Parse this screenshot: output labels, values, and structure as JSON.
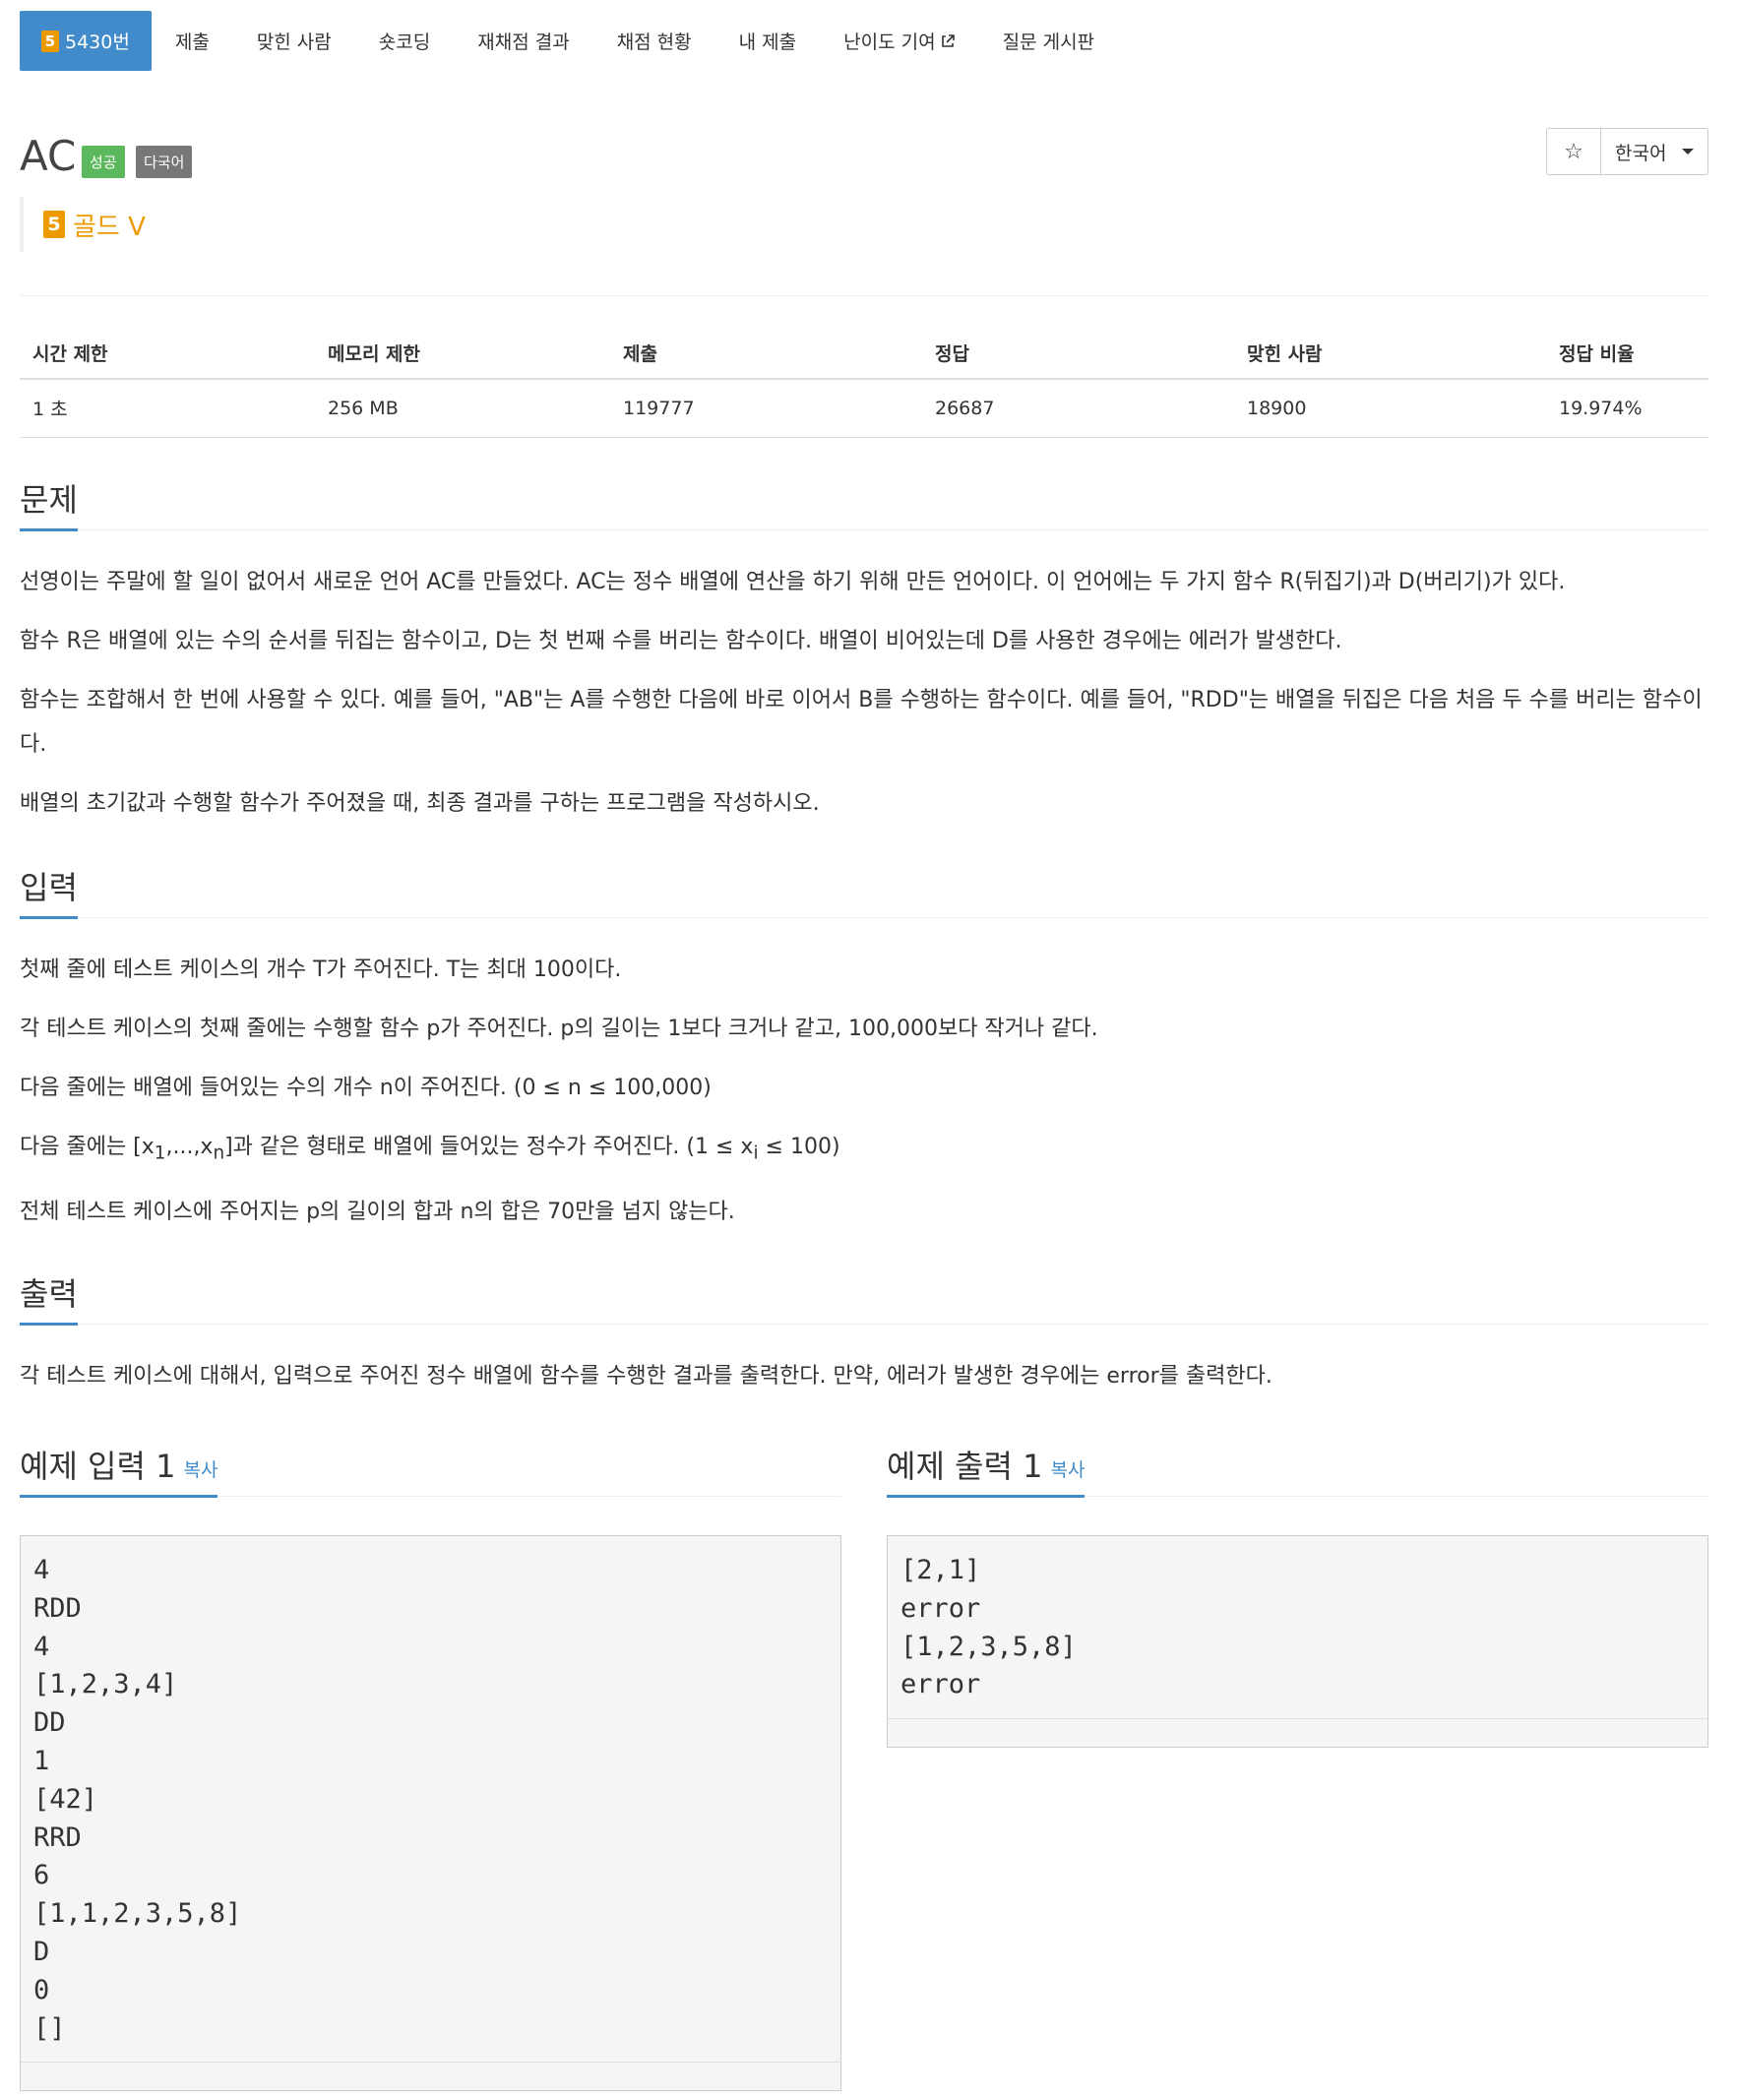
{
  "nav": {
    "problem_tier": "5",
    "problem_id": "5430번",
    "items": [
      "제출",
      "맞힌 사람",
      "숏코딩",
      "재채점 결과",
      "채점 현황",
      "내 제출",
      "난이도 기여",
      "질문 게시판"
    ]
  },
  "title": {
    "text": "AC",
    "label_success": "성공",
    "label_multilang": "다국어",
    "star": "☆",
    "language": "한국어",
    "tier_number": "5",
    "tier_text": "골드 V"
  },
  "stats": {
    "headers": [
      "시간 제한",
      "메모리 제한",
      "제출",
      "정답",
      "맞힌 사람",
      "정답 비율"
    ],
    "values": [
      "1 초",
      "256 MB",
      "119777",
      "26687",
      "18900",
      "19.974%"
    ]
  },
  "problem": {
    "title": "문제",
    "paragraphs": [
      "선영이는 주말에 할 일이 없어서 새로운 언어 AC를 만들었다. AC는 정수 배열에 연산을 하기 위해 만든 언어이다. 이 언어에는 두 가지 함수 R(뒤집기)과 D(버리기)가 있다.",
      "함수 R은 배열에 있는 수의 순서를 뒤집는 함수이고, D는 첫 번째 수를 버리는 함수이다. 배열이 비어있는데 D를 사용한 경우에는 에러가 발생한다.",
      "함수는 조합해서 한 번에 사용할 수 있다. 예를 들어, \"AB\"는 A를 수행한 다음에 바로 이어서 B를 수행하는 함수이다. 예를 들어, \"RDD\"는 배열을 뒤집은 다음 처음 두 수를 버리는 함수이다.",
      "배열의 초기값과 수행할 함수가 주어졌을 때, 최종 결과를 구하는 프로그램을 작성하시오."
    ]
  },
  "input": {
    "title": "입력",
    "p1": "첫째 줄에 테스트 케이스의 개수 T가 주어진다. T는 최대 100이다.",
    "p2": "각 테스트 케이스의 첫째 줄에는 수행할 함수 p가 주어진다. p의 길이는 1보다 크거나 같고, 100,000보다 작거나 같다.",
    "p3": "다음 줄에는 배열에 들어있는 수의 개수 n이 주어진다. (0 ≤ n ≤ 100,000)",
    "p4_prefix": "다음 줄에는 [x",
    "p4_sub1": "1",
    "p4_mid": ",...,x",
    "p4_subn": "n",
    "p4_suffix": "]과 같은 형태로 배열에 들어있는 정수가 주어진다. (1 ≤ x",
    "p4_subi": "i",
    "p4_end": " ≤ 100)",
    "p5": "전체 테스트 케이스에 주어지는 p의 길이의 합과 n의 합은 70만을 넘지 않는다."
  },
  "output": {
    "title": "출력",
    "p1": "각 테스트 케이스에 대해서, 입력으로 주어진 정수 배열에 함수를 수행한 결과를 출력한다. 만약, 에러가 발생한 경우에는 error를 출력한다."
  },
  "sample_input": {
    "title": "예제 입력 1",
    "copy": "복사",
    "lines": [
      "4",
      "RDD",
      "4",
      "[1,2,3,4]",
      "DD",
      "1",
      "[42]",
      "RRD",
      "6",
      "[1,1,2,3,5,8]",
      "D",
      "0",
      "[]"
    ]
  },
  "sample_output": {
    "title": "예제 출력 1",
    "copy": "복사",
    "lines": [
      "[2,1]",
      "error",
      "[1,2,3,5,8]",
      "error"
    ]
  }
}
